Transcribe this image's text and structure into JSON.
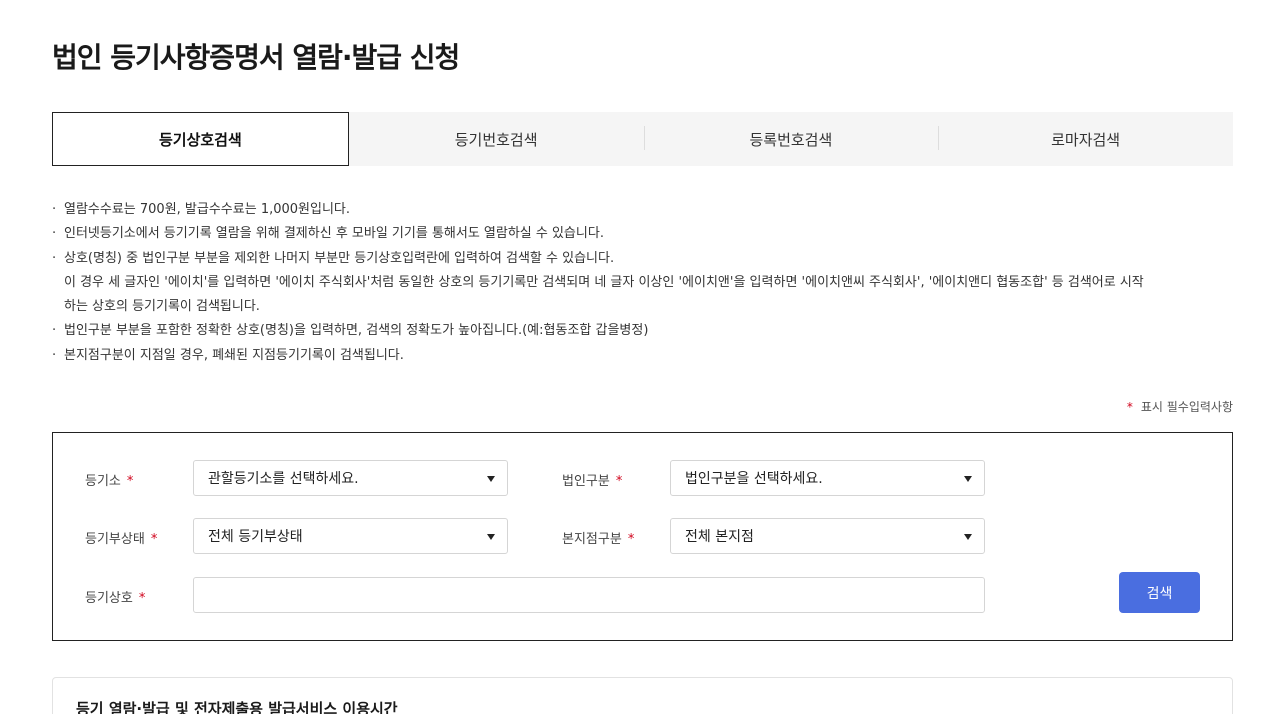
{
  "page": {
    "title": "법인 등기사항증명서 열람·발급 신청"
  },
  "tabs": [
    {
      "label": "등기상호검색",
      "active": true
    },
    {
      "label": "등기번호검색",
      "active": false
    },
    {
      "label": "등록번호검색",
      "active": false
    },
    {
      "label": "로마자검색",
      "active": false
    }
  ],
  "notice": {
    "items": [
      "열람수수료는 700원, 발급수수료는 1,000원입니다.",
      "인터넷등기소에서 등기기록 열람을 위해 결제하신 후 모바일 기기를 통해서도 열람하실 수 있습니다.",
      "상호(명칭) 중 법인구분 부분을 제외한 나머지 부분만 등기상호입력란에 입력하여 검색할 수 있습니다.",
      "법인구분 부분을 포함한 정확한 상호(명칭)을 입력하면, 검색의 정확도가 높아집니다.(예:협동조합 갑을병정)",
      "본지점구분이 지점일 경우, 폐쇄된 지점등기기록이 검색됩니다."
    ],
    "continuation": [
      "이 경우 세 글자인 '에이치'를 입력하면 '에이치 주식회사'처럼 동일한 상호의 등기기록만 검색되며 네 글자 이상인 '에이치앤'을 입력하면 '에이치앤씨 주식회사', '에이치앤디 협동조합' 등 검색어로 시작",
      "하는 상호의 등기기록이 검색됩니다."
    ]
  },
  "required_legend": {
    "star": "*",
    "text": "표시 필수입력사항"
  },
  "form": {
    "registry_office": {
      "label": "등기소",
      "star": "*",
      "value": "관할등기소를 선택하세요."
    },
    "corp_type": {
      "label": "법인구분",
      "star": "*",
      "value": "법인구분을 선택하세요."
    },
    "registry_status": {
      "label": "등기부상태",
      "star": "*",
      "value": "전체 등기부상태"
    },
    "branch_type": {
      "label": "본지점구분",
      "star": "*",
      "value": "전체 본지점"
    },
    "trade_name": {
      "label": "등기상호",
      "star": "*",
      "value": "",
      "placeholder": ""
    },
    "search_label": "검색"
  },
  "info": {
    "title": "등기 열람·발급 및 전자제출용 발급서비스 이용시간"
  }
}
